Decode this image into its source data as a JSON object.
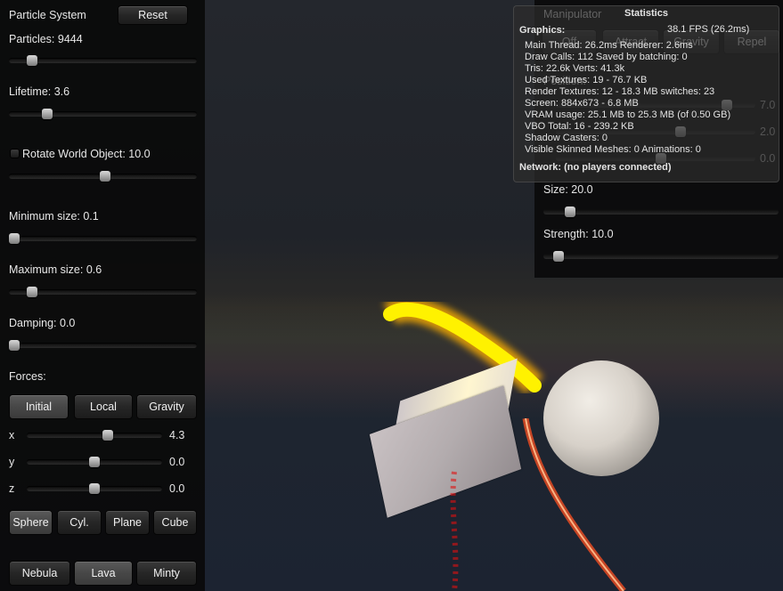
{
  "left_panel": {
    "title": "Particle System",
    "reset_label": "Reset",
    "particles_label": "Particles: 9444",
    "particles_slider": 0.12,
    "lifetime_label": "Lifetime: 3.6",
    "lifetime_slider": 0.2,
    "rotate_label": "Rotate World Object: 10.0",
    "rotate_checked": false,
    "rotate_slider": 0.52,
    "min_size_label": "Minimum size: 0.1",
    "min_size_slider": 0.0,
    "max_size_label": "Maximum size: 0.6",
    "max_size_slider": 0.12,
    "damping_label": "Damping: 0.0",
    "damping_slider": 0.0,
    "forces_label": "Forces:",
    "force_tabs": [
      {
        "label": "Initial",
        "active": true
      },
      {
        "label": "Local",
        "active": false
      },
      {
        "label": "Gravity",
        "active": false
      }
    ],
    "axes": [
      {
        "label": "x",
        "value": "4.3",
        "slider": 0.6
      },
      {
        "label": "y",
        "value": "0.0",
        "slider": 0.5
      },
      {
        "label": "z",
        "value": "0.0",
        "slider": 0.5
      }
    ],
    "shapes": [
      {
        "label": "Sphere",
        "active": true
      },
      {
        "label": "Cyl.",
        "active": false
      },
      {
        "label": "Plane",
        "active": false
      },
      {
        "label": "Cube",
        "active": false
      }
    ],
    "presets": [
      {
        "label": "Nebula",
        "active": false
      },
      {
        "label": "Lava",
        "active": true
      },
      {
        "label": "Minty",
        "active": false
      }
    ]
  },
  "manipulator": {
    "title": "Manipulator",
    "modes": [
      "Off",
      "Attract",
      "Gravity",
      "Repel"
    ],
    "position_label": "Position:",
    "values": [
      "7.0",
      "2.0",
      "0.0"
    ],
    "size_label": "Size: 20.0",
    "size_slider": 0.1,
    "strength_label": "Strength: 10.0",
    "strength_slider": 0.06
  },
  "statistics": {
    "title": "Statistics",
    "graphics_header": "Graphics:",
    "fps": "38.1 FPS (26.2ms)",
    "lines": [
      "Main Thread: 26.2ms  Renderer: 2.6ms",
      "Draw Calls: 112   Saved by batching: 0",
      "Tris: 22.6k    Verts: 41.3k",
      "Used Textures: 19 - 76.7 KB",
      "Render Textures: 12 - 18.3 MB  switches: 23",
      "Screen: 884x673 - 6.8 MB",
      "VRAM usage: 25.1 MB to 25.3 MB (of 0.50 GB)",
      "VBO Total: 16 - 239.2 KB",
      "Shadow Casters: 0",
      "Visible Skinned Meshes: 0      Animations: 0"
    ],
    "network": "Network: (no players connected)"
  },
  "colors": {
    "particle_core": "#fff200",
    "particle_glow": "#ffb000",
    "particle_trail": "#ff3010"
  }
}
